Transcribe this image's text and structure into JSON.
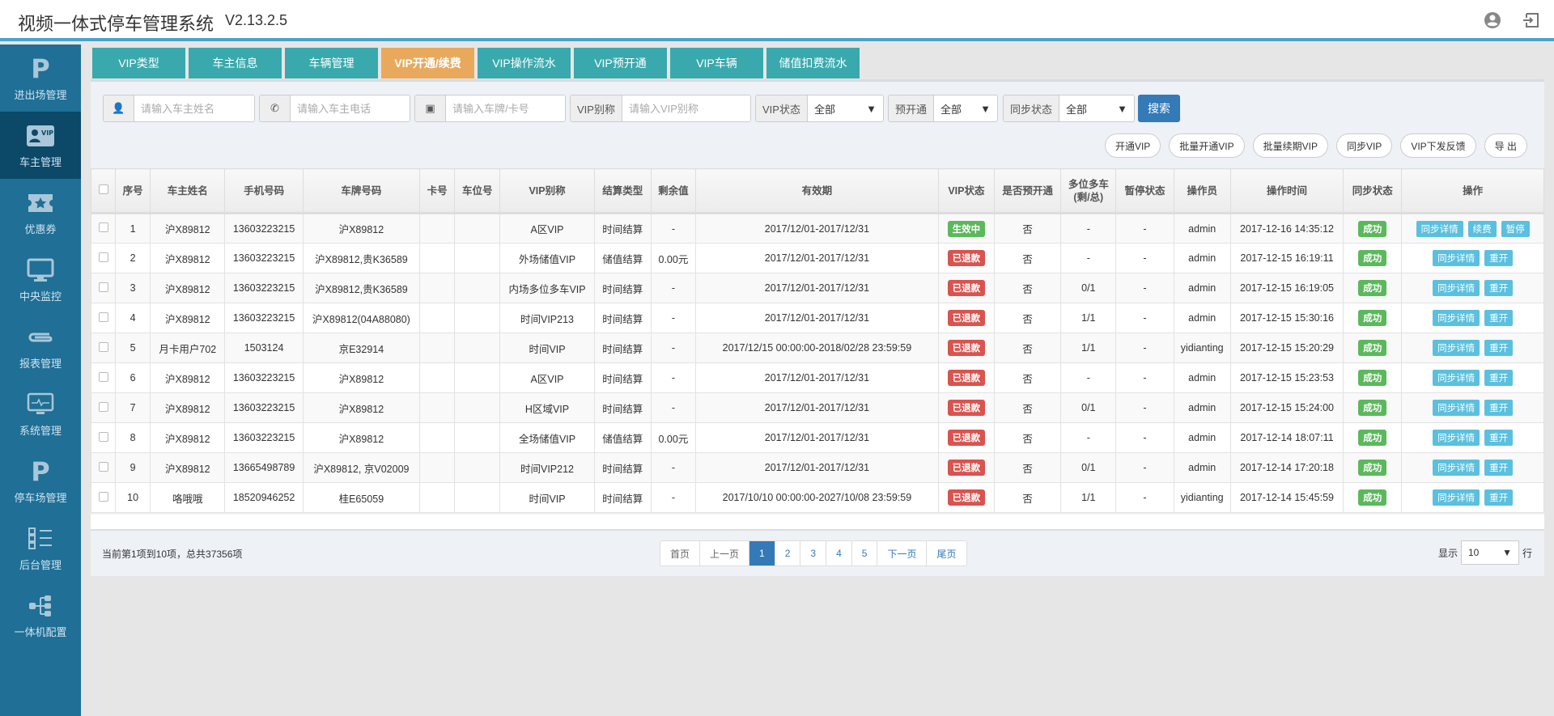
{
  "header": {
    "title": "视频一体式停车管理系统",
    "version": "V2.13.2.5"
  },
  "sidebar": {
    "items": [
      {
        "label": "进出场管理",
        "icon": "parking-icon"
      },
      {
        "label": "车主管理",
        "icon": "vip-card-icon",
        "active": true
      },
      {
        "label": "优惠券",
        "icon": "coupon-icon"
      },
      {
        "label": "中央监控",
        "icon": "monitor-icon"
      },
      {
        "label": "报表管理",
        "icon": "paperclip-icon"
      },
      {
        "label": "系统管理",
        "icon": "system-monitor-icon"
      },
      {
        "label": "停车场管理",
        "icon": "parking-icon"
      },
      {
        "label": "后台管理",
        "icon": "list-icon"
      },
      {
        "label": "一体机配置",
        "icon": "network-icon"
      }
    ]
  },
  "tabs": [
    {
      "label": "VIP类型"
    },
    {
      "label": "车主信息"
    },
    {
      "label": "车辆管理"
    },
    {
      "label": "VIP开通/续费",
      "active": true
    },
    {
      "label": "VIP操作流水"
    },
    {
      "label": "VIP预开通"
    },
    {
      "label": "VIP车辆"
    },
    {
      "label": "储值扣费流水"
    }
  ],
  "filters": {
    "name_placeholder": "请输入车主姓名",
    "phone_placeholder": "请输入车主电话",
    "plate_placeholder": "请输入车牌/卡号",
    "alias_label": "VIP别称",
    "alias_placeholder": "请输入VIP别称",
    "status_label": "VIP状态",
    "status_value": "全部",
    "preopen_label": "预开通",
    "preopen_value": "全部",
    "sync_label": "同步状态",
    "sync_value": "全部",
    "search": "搜索"
  },
  "actions": [
    "开通VIP",
    "批量开通VIP",
    "批量续期VIP",
    "同步VIP",
    "VIP下发反馈",
    "导 出"
  ],
  "columns": [
    "序号",
    "车主姓名",
    "手机号码",
    "车牌号码",
    "卡号",
    "车位号",
    "VIP别称",
    "结算类型",
    "剩余值",
    "有效期",
    "VIP状态",
    "是否预开通",
    "多位多车(剩/总)",
    "暂停状态",
    "操作员",
    "操作时间",
    "同步状态",
    "操作"
  ],
  "rows": [
    [
      "1",
      "沪X89812",
      "13603223215",
      "沪X89812",
      "",
      "",
      "A区VIP",
      "时间结算",
      "-",
      "2017/12/01-2017/12/31",
      "生效中",
      "否",
      "-",
      "-",
      "admin",
      "2017-12-16 14:35:12",
      "成功"
    ],
    [
      "2",
      "沪X89812",
      "13603223215",
      "沪X89812,贵K36589",
      "",
      "",
      "外场储值VIP",
      "储值结算",
      "0.00元",
      "2017/12/01-2017/12/31",
      "已退款",
      "否",
      "-",
      "-",
      "admin",
      "2017-12-15 16:19:11",
      "成功"
    ],
    [
      "3",
      "沪X89812",
      "13603223215",
      "沪X89812,贵K36589",
      "",
      "",
      "内场多位多车VIP",
      "时间结算",
      "-",
      "2017/12/01-2017/12/31",
      "已退款",
      "否",
      "0/1",
      "-",
      "admin",
      "2017-12-15 16:19:05",
      "成功"
    ],
    [
      "4",
      "沪X89812",
      "13603223215",
      "沪X89812(04A88080)",
      "",
      "",
      "时间VIP213",
      "时间结算",
      "-",
      "2017/12/01-2017/12/31",
      "已退款",
      "否",
      "1/1",
      "-",
      "admin",
      "2017-12-15 15:30:16",
      "成功"
    ],
    [
      "5",
      "月卡用户702",
      "1503124",
      "京E32914",
      "",
      "",
      "时间VIP",
      "时间结算",
      "-",
      "2017/12/15 00:00:00-2018/02/28 23:59:59",
      "已退款",
      "否",
      "1/1",
      "-",
      "yidianting",
      "2017-12-15 15:20:29",
      "成功"
    ],
    [
      "6",
      "沪X89812",
      "13603223215",
      "沪X89812",
      "",
      "",
      "A区VIP",
      "时间结算",
      "-",
      "2017/12/01-2017/12/31",
      "已退款",
      "否",
      "-",
      "-",
      "admin",
      "2017-12-15 15:23:53",
      "成功"
    ],
    [
      "7",
      "沪X89812",
      "13603223215",
      "沪X89812",
      "",
      "",
      "H区域VIP",
      "时间结算",
      "-",
      "2017/12/01-2017/12/31",
      "已退款",
      "否",
      "0/1",
      "-",
      "admin",
      "2017-12-15 15:24:00",
      "成功"
    ],
    [
      "8",
      "沪X89812",
      "13603223215",
      "沪X89812",
      "",
      "",
      "全场储值VIP",
      "储值结算",
      "0.00元",
      "2017/12/01-2017/12/31",
      "已退款",
      "否",
      "-",
      "-",
      "admin",
      "2017-12-14 18:07:11",
      "成功"
    ],
    [
      "9",
      "沪X89812",
      "13665498789",
      "沪X89812, 京V02009",
      "",
      "",
      "时间VIP212",
      "时间结算",
      "-",
      "2017/12/01-2017/12/31",
      "已退款",
      "否",
      "0/1",
      "-",
      "admin",
      "2017-12-14 17:20:18",
      "成功"
    ],
    [
      "10",
      "咯哦哦",
      "18520946252",
      "桂E65059",
      "",
      "",
      "时间VIP",
      "时间结算",
      "-",
      "2017/10/10 00:00:00-2027/10/08 23:59:59",
      "已退款",
      "否",
      "1/1",
      "-",
      "yidianting",
      "2017-12-14 15:45:59",
      "成功"
    ]
  ],
  "row_ops": {
    "active": [
      "同步详情",
      "续费",
      "暂停"
    ],
    "refunded": [
      "同步详情",
      "重开"
    ]
  },
  "colors": {
    "active_status": "#5cb85c",
    "refunded_status": "#d9534f",
    "sync_success": "#5cb85c"
  },
  "pagination": {
    "info": "当前第1项到10项，总共37356项",
    "first": "首页",
    "prev": "上一页",
    "pages": [
      "1",
      "2",
      "3",
      "4",
      "5"
    ],
    "current": "1",
    "next": "下一页",
    "last": "尾页",
    "show_label": "显示",
    "page_size": "10",
    "rows_label": "行"
  }
}
